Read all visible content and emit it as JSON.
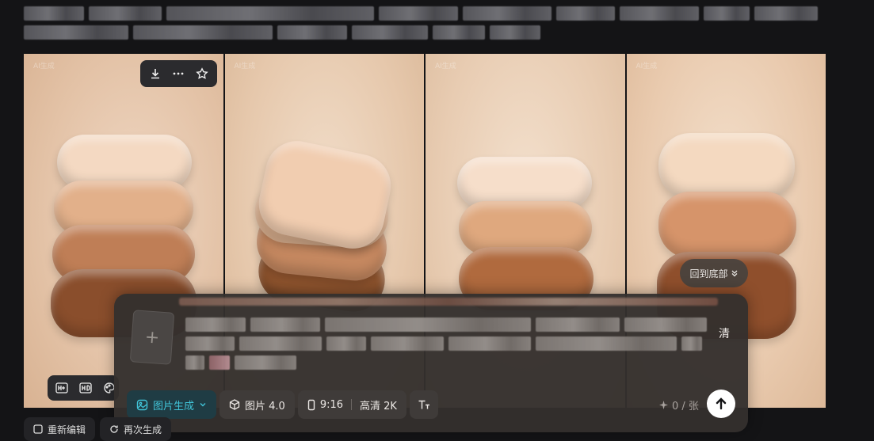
{
  "prompt_blurred": true,
  "images": [
    {
      "watermark": "AI生成"
    },
    {
      "watermark": "AI生成"
    },
    {
      "watermark": "AI生成"
    },
    {
      "watermark": "AI生成"
    }
  ],
  "image_toolbar": {
    "download_icon": "download-icon",
    "more_icon": "more-icon",
    "favorite_icon": "star-icon"
  },
  "image_tools_bottom": {
    "icons": [
      "hd-plus-icon",
      "hd-icon",
      "palette-icon"
    ]
  },
  "back_to_bottom": {
    "label": "回到底部"
  },
  "composer": {
    "upload_icon": "plus-icon",
    "trailing_char": "清",
    "mode": {
      "label": "图片生成"
    },
    "model": {
      "label": "图片 4.0"
    },
    "ratio": {
      "label": "9:16"
    },
    "quality": {
      "label": "高清 2K"
    },
    "counter": {
      "label": "0 / 张"
    }
  },
  "below_buttons": [
    {
      "label": "重新编辑"
    },
    {
      "label": "再次生成"
    }
  ],
  "colors": {
    "accent": "#41c3d7",
    "background": "#141416",
    "panel": "#34302e"
  }
}
